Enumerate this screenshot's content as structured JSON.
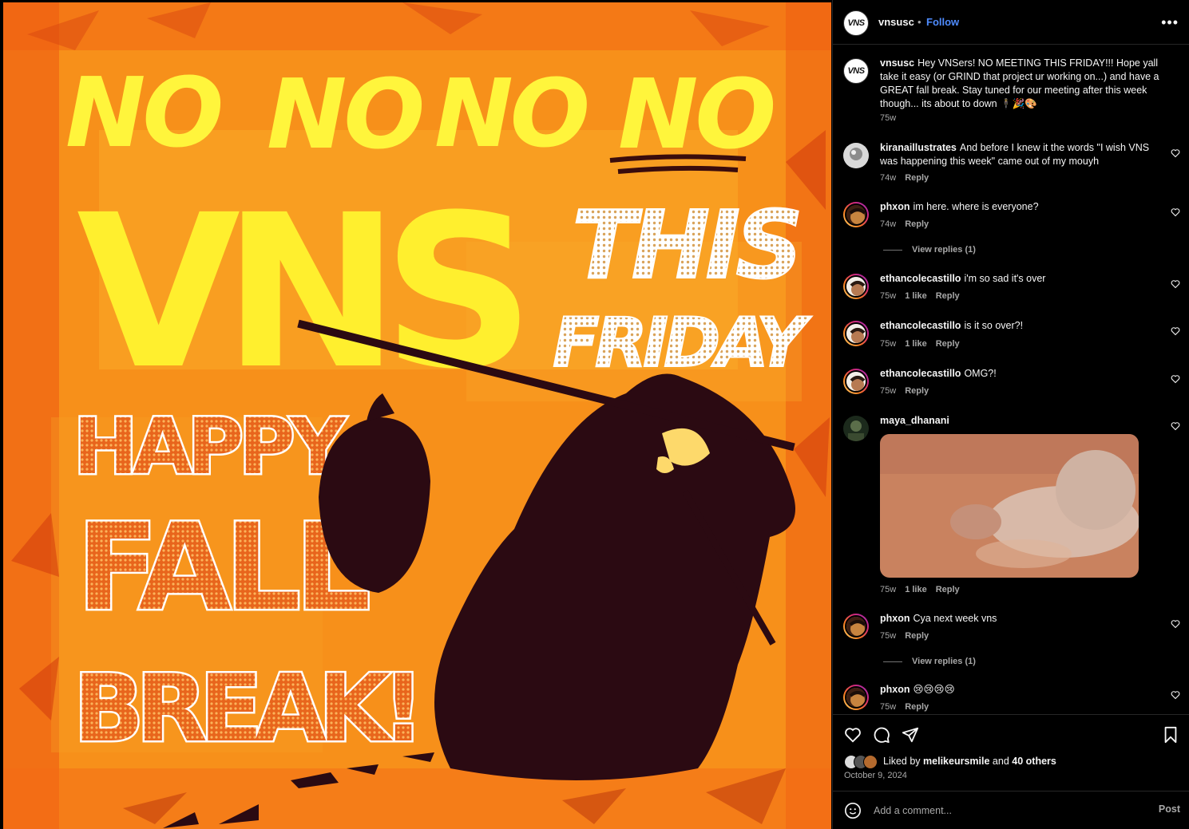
{
  "post": {
    "username": "vnsusc",
    "follow_label": "Follow",
    "dot": "•",
    "more_label": "•••",
    "avatar_text": "VNS",
    "image": {
      "line1": "NO NO NO NO",
      "vns": "VNS",
      "this": "THIS",
      "friday": "FRIDAY",
      "happy": "HAPPY",
      "fall": "FALL",
      "break": "BREAK!"
    },
    "caption": {
      "username": "vnsusc",
      "text": "Hey VNSers! NO MEETING THIS FRIDAY!!! Hope yall take it easy (or GRIND that project ur working on...) and have a GREAT fall break. Stay tuned for our meeting after this week though... its about to down 🕴🎉🎨",
      "time": "75w"
    }
  },
  "comments": [
    {
      "username": "kiranaillustrates",
      "text": "And before I knew it the words \"I wish VNS was happening this week\" came out of my mouyh",
      "time": "74w",
      "likes": "",
      "reply": "Reply"
    },
    {
      "username": "phxon",
      "text": "im here. where is everyone?",
      "time": "74w",
      "likes": "",
      "reply": "Reply",
      "view_replies": "View replies (1)"
    },
    {
      "username": "ethancolecastillo",
      "text": "i'm so sad it's over",
      "time": "75w",
      "likes": "1 like",
      "reply": "Reply"
    },
    {
      "username": "ethancolecastillo",
      "text": "is it so over?!",
      "time": "75w",
      "likes": "1 like",
      "reply": "Reply"
    },
    {
      "username": "ethancolecastillo",
      "text": "OMG?!",
      "time": "75w",
      "likes": "",
      "reply": "Reply"
    },
    {
      "username": "maya_dhanani",
      "text": "",
      "time": "75w",
      "likes": "1 like",
      "reply": "Reply"
    },
    {
      "username": "phxon",
      "text": "Cya next week vns",
      "time": "75w",
      "likes": "",
      "reply": "Reply",
      "view_replies": "View replies (1)"
    },
    {
      "username": "phxon",
      "text": "😢😢😢😢",
      "time": "75w",
      "likes": "",
      "reply": "Reply"
    }
  ],
  "footer": {
    "liked_prefix": "Liked by",
    "liked_user": "melikeursmile",
    "liked_and": "and",
    "liked_others": "40 others",
    "date": "October 9, 2024",
    "comment_placeholder": "Add a comment...",
    "post_label": "Post"
  },
  "colors": {
    "accent": "#4f8cff",
    "background": "#000000",
    "text": "#f5f5f5",
    "muted": "#a8a8a8",
    "image_orange": "#f58a12",
    "image_yellow": "#ffef2e"
  }
}
